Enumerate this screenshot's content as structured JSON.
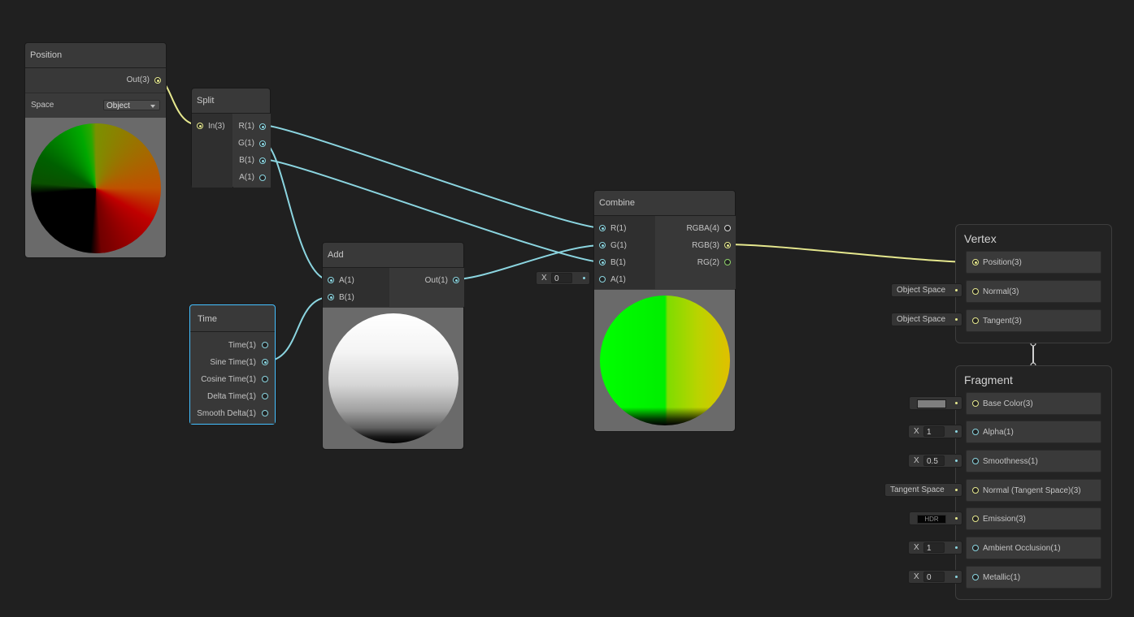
{
  "colors": {
    "background": "#202020",
    "float_wire": "#8bd5e0",
    "vector3_wire": "#e6e88e",
    "vector2_port": "#8fd36a",
    "selected_outline": "#44c0ff"
  },
  "nodes": {
    "position": {
      "title": "Position",
      "output": "Out(3)",
      "space_label": "Space",
      "space_value": "Object"
    },
    "split": {
      "title": "Split",
      "input": "In(3)",
      "outputs": [
        "R(1)",
        "G(1)",
        "B(1)",
        "A(1)"
      ]
    },
    "time": {
      "title": "Time",
      "outputs": [
        "Time(1)",
        "Sine Time(1)",
        "Cosine Time(1)",
        "Delta Time(1)",
        "Smooth Delta(1)"
      ]
    },
    "add": {
      "title": "Add",
      "inputs": [
        "A(1)",
        "B(1)"
      ],
      "output": "Out(1)"
    },
    "combine": {
      "title": "Combine",
      "inputs": [
        "R(1)",
        "G(1)",
        "B(1)",
        "A(1)"
      ],
      "outputs": [
        "RGBA(4)",
        "RGB(3)",
        "RG(2)"
      ],
      "a_field": {
        "axis": "X",
        "value": "0"
      }
    }
  },
  "vertex": {
    "title": "Vertex",
    "blocks": [
      {
        "label": "Position(3)"
      },
      {
        "label": "Normal(3)",
        "field": "Object Space"
      },
      {
        "label": "Tangent(3)",
        "field": "Object Space"
      }
    ]
  },
  "fragment": {
    "title": "Fragment",
    "blocks": [
      {
        "label": "Base Color(3)",
        "field_type": "color",
        "color": "#7f7f7f"
      },
      {
        "label": "Alpha(1)",
        "field_axis": "X",
        "field_value": "1"
      },
      {
        "label": "Smoothness(1)",
        "field_axis": "X",
        "field_value": "0.5"
      },
      {
        "label": "Normal (Tangent Space)(3)",
        "field": "Tangent Space"
      },
      {
        "label": "Emission(3)",
        "field_type": "hdr",
        "hdr_text": "HDR"
      },
      {
        "label": "Ambient Occlusion(1)",
        "field_axis": "X",
        "field_value": "1"
      },
      {
        "label": "Metallic(1)",
        "field_axis": "X",
        "field_value": "0"
      }
    ]
  }
}
